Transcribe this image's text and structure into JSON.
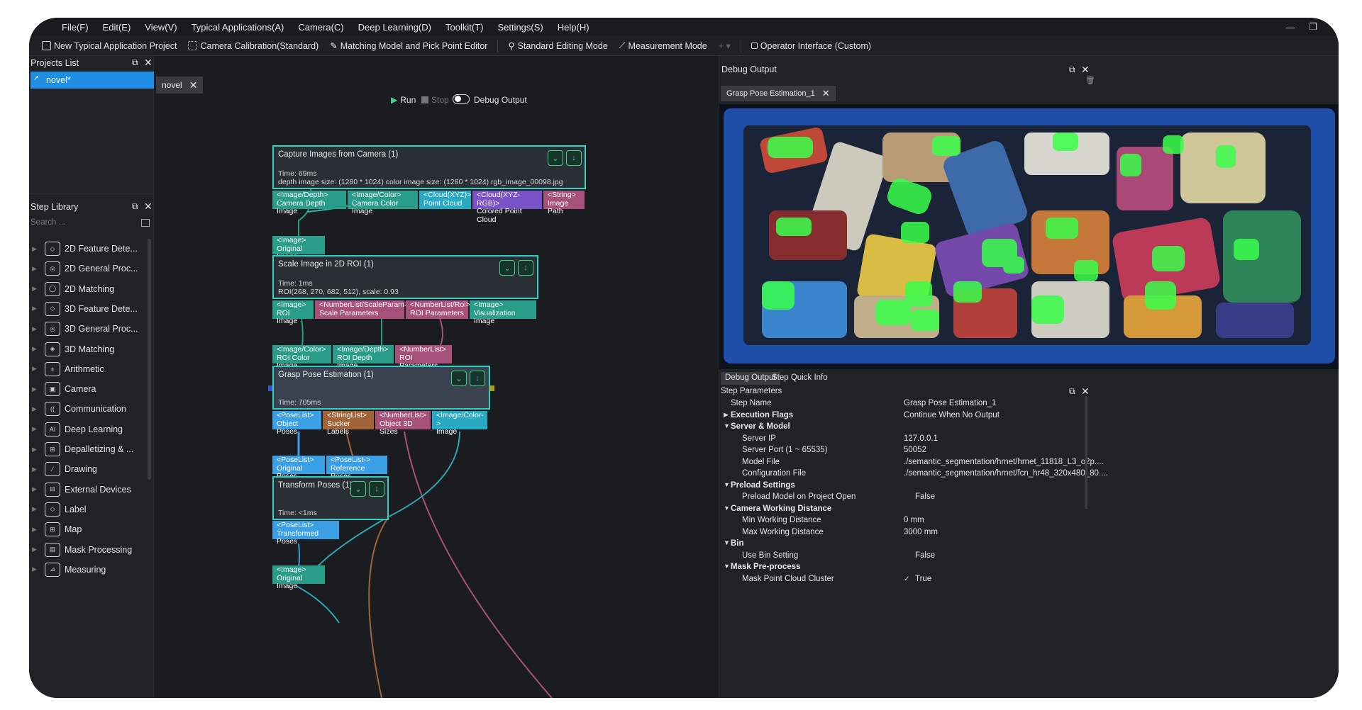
{
  "menu": [
    "File(F)",
    "Edit(E)",
    "View(V)",
    "Typical Applications(A)",
    "Camera(C)",
    "Deep Learning(D)",
    "Toolkit(T)",
    "Settings(S)",
    "Help(H)"
  ],
  "toolbar": {
    "new_typical": "New Typical Application Project",
    "camera_calib": "Camera Calibration(Standard)",
    "matching_model": "Matching Model and Pick Point Editor",
    "standard_mode": "Standard Editing Mode",
    "measurement_mode": "Measurement Mode",
    "operator_interface": "Operator Interface (Custom)"
  },
  "projects": {
    "title": "Projects List",
    "item": "novel*"
  },
  "step_library": {
    "title": "Step Library",
    "search_placeholder": "Search ...",
    "items": [
      "2D Feature Dete...",
      "2D General Proc...",
      "2D Matching",
      "3D Feature Dete...",
      "3D General Proc...",
      "3D Matching",
      "Arithmetic",
      "Camera",
      "Communication",
      "Deep Learning",
      "Depalletizing & ...",
      "Drawing",
      "External Devices",
      "Label",
      "Map",
      "Mask Processing",
      "Measuring"
    ]
  },
  "canvas": {
    "tab": "novel",
    "run": "Run",
    "stop": "Stop",
    "debug_output": "Debug Output"
  },
  "nodes": {
    "capture": {
      "title": "Capture Images from Camera (1)",
      "time": "Time: 69ms",
      "info": "depth image size: (1280 * 1024)  color image size: (1280 * 1024)  rgb_image_00098.jpg"
    },
    "scale": {
      "title": "Scale Image in 2D ROI (1)",
      "time": "Time: 1ms",
      "info": "ROI(268, 270, 682, 512), scale: 0.93"
    },
    "grasp": {
      "title": "Grasp Pose Estimation (1)",
      "time": "Time: 705ms"
    },
    "transform": {
      "title": "Transform Poses (1)",
      "time": "Time: <1ms"
    }
  },
  "ports": {
    "capture_out": [
      {
        "type": "<Image/Depth>",
        "name": "Camera Depth Image"
      },
      {
        "type": "<Image/Color>",
        "name": "Camera Color Image"
      },
      {
        "type": "<Cloud(XYZ)>",
        "name": "Point Cloud"
      },
      {
        "type": "<Cloud(XYZ-RGB)>",
        "name": "Colored Point Cloud"
      },
      {
        "type": "<String>",
        "name": "Image Path"
      }
    ],
    "scale_in": {
      "type": "<Image>",
      "name": "Original Image"
    },
    "scale_out": [
      {
        "type": "<Image>",
        "name": "ROI Image"
      },
      {
        "type": "<NumberList/ScaleParam>",
        "name": "Scale Parameters"
      },
      {
        "type": "<NumberList/Roi>",
        "name": "ROI Parameters"
      },
      {
        "type": "<Image>",
        "name": "Visualization Image"
      }
    ],
    "grasp_in": [
      {
        "type": "<Image/Color>",
        "name": "ROI Color Image"
      },
      {
        "type": "<Image/Depth>",
        "name": "ROI Depth Image"
      },
      {
        "type": "<NumberList>",
        "name": "ROI Parameters"
      }
    ],
    "grasp_out": [
      {
        "type": "<PoseList>",
        "name": "Object Poses"
      },
      {
        "type": "<StringList>",
        "name": "Sucker Labels"
      },
      {
        "type": "<NumberList>",
        "name": "Object 3D Sizes"
      },
      {
        "type": "<Image/Color->",
        "name": "Image"
      }
    ],
    "transform_in": [
      {
        "type": "<PoseList>",
        "name": "Original Poses"
      },
      {
        "type": "<PoseList->",
        "name": "Reference Poses"
      }
    ],
    "transform_out": {
      "type": "<PoseList>",
      "name": "Transformed Poses"
    },
    "next_in": {
      "type": "<Image>",
      "name": "Original Image"
    }
  },
  "debug": {
    "title": "Debug Output",
    "image_tab": "Grasp Pose Estimation_1",
    "tab_debug": "Debug Output",
    "tab_quick": "Step Quick Info",
    "params_title": "Step Parameters"
  },
  "params": [
    {
      "key": "Step Name",
      "value": "Grasp Pose Estimation_1",
      "level": 0,
      "header": false
    },
    {
      "key": "Execution Flags",
      "value": "Continue When No Output",
      "level": 0,
      "header": true,
      "collapsed": true
    },
    {
      "key": "Server & Model",
      "value": "",
      "level": 0,
      "header": true
    },
    {
      "key": "Server IP",
      "value": "127.0.0.1",
      "level": 1
    },
    {
      "key": "Server Port (1 ~ 65535)",
      "value": "50052",
      "level": 1
    },
    {
      "key": "Model File",
      "value": "./semantic_segmentation/hrnet/hrnet_11818_L3_o2p....",
      "level": 1
    },
    {
      "key": "Configuration File",
      "value": "./semantic_segmentation/hrnet/fcn_hr48_320x480_80....",
      "level": 1
    },
    {
      "key": "Preload Settings",
      "value": "",
      "level": 0,
      "header": true
    },
    {
      "key": "Preload Model on Project Open",
      "value": "False",
      "level": 1,
      "checkbox": true
    },
    {
      "key": "Camera Working Distance",
      "value": "",
      "level": 0,
      "header": true
    },
    {
      "key": "Min Working Distance",
      "value": "0 mm",
      "level": 1
    },
    {
      "key": "Max Working Distance",
      "value": "3000 mm",
      "level": 1
    },
    {
      "key": "Bin",
      "value": "",
      "level": 0,
      "header": true
    },
    {
      "key": "Use Bin Setting",
      "value": "False",
      "level": 1,
      "checkbox": true
    },
    {
      "key": "Mask Pre-process",
      "value": "",
      "level": 0,
      "header": true
    },
    {
      "key": "Mask Point Cloud Cluster",
      "value": "True",
      "level": 1,
      "checkbox": true,
      "checked": true
    }
  ]
}
